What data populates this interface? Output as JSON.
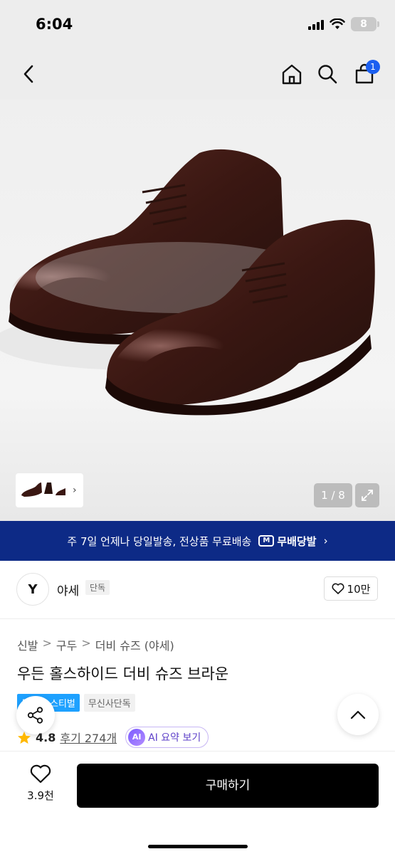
{
  "status_bar": {
    "time": "6:04",
    "battery": "8"
  },
  "nav": {
    "cart_count": "1",
    "icons": [
      "back-icon",
      "home-icon",
      "search-icon",
      "cart-icon"
    ]
  },
  "gallery": {
    "page_indicator": "1 / 8",
    "thumb_arrow": "›"
  },
  "banner": {
    "text": "주 7일 언제나 당일발송, 전상품 무료배송",
    "badge_mark": "M",
    "badge_label": "무배당발",
    "chevron": "›",
    "background": "#0d2a86"
  },
  "brand": {
    "logo_text": "Y",
    "name": "야세",
    "tag": "단독",
    "likes": "10만"
  },
  "product": {
    "breadcrumb": [
      "신발",
      "구두",
      "더비 슈즈 (야세)"
    ],
    "title": "우든 홀스하이드 더비 슈즈 브라운",
    "tags": [
      "무신사 스티벌",
      "무신사단독"
    ],
    "rating": "4.8",
    "reviews": "후기 274개",
    "ai_badge": "AI",
    "ai_label": "AI 요약 보기"
  },
  "bottom_bar": {
    "wish_count": "3.9천",
    "buy_label": "구매하기"
  },
  "colors": {
    "accent": "#1b5ff0",
    "star": "#ffb800",
    "buy_button": "#000000"
  }
}
